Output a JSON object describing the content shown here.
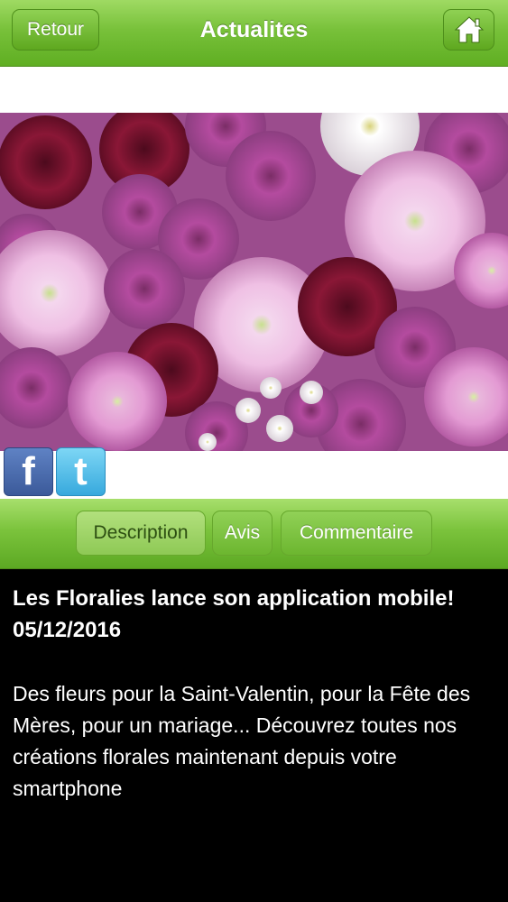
{
  "header": {
    "back_label": "Retour",
    "title": "Actualites",
    "home_icon": "home-icon"
  },
  "hero": {
    "icon": "flower-photo"
  },
  "share": {
    "facebook_letter": "f",
    "twitter_letter": "t"
  },
  "tabs": [
    {
      "label": "Description",
      "active": true
    },
    {
      "label": "Avis",
      "active": false
    },
    {
      "label": "Commentaire",
      "active": false
    }
  ],
  "article": {
    "title": "Les Floralies lance son application mobile!",
    "date": "05/12/2016",
    "body": "Des fleurs pour la Saint-Valentin, pour la Fête des Mères, pour un mariage... Découvrez toutes nos créations florales maintenant depuis votre smartphone"
  },
  "colors": {
    "bar_green": "#6cb62f",
    "facebook_blue": "#3b5a9a",
    "twitter_blue": "#37a9dd",
    "content_bg": "#000000"
  }
}
